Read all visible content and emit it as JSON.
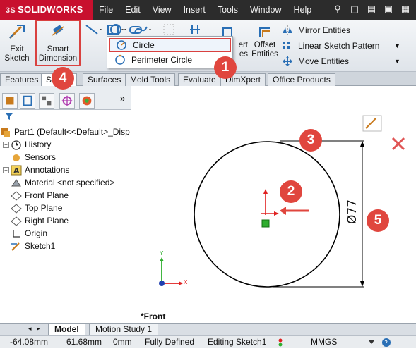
{
  "app": {
    "logo_text": "SOLIDWORKS",
    "logo_prefix": "3S"
  },
  "menu": [
    "File",
    "Edit",
    "View",
    "Insert",
    "Tools",
    "Window",
    "Help"
  ],
  "commands": {
    "exit_sketch": "Exit Sketch",
    "smart_dimension": "Smart Dimension",
    "convert_entities_fragment": "ert\nes",
    "offset_entities": "Offset Entities",
    "mirror_entities": "Mirror Entities",
    "linear_sketch_pattern": "Linear Sketch Pattern",
    "move_entities": "Move Entities"
  },
  "dropdown": {
    "items": [
      "Circle",
      "Perimeter Circle"
    ]
  },
  "ribbon_tabs": [
    "Features",
    "Sketch",
    "Surfaces",
    "Mold Tools",
    "Evaluate",
    "DimXpert",
    "Office Products"
  ],
  "feature_tree": {
    "filter_icon": "filter-icon",
    "root": "Part1  (Default<<Default>_Disp",
    "items": [
      {
        "label": "History",
        "icon": "history-icon",
        "expandable": true
      },
      {
        "label": "Sensors",
        "icon": "sensors-icon",
        "expandable": false
      },
      {
        "label": "Annotations",
        "icon": "annotations-icon",
        "expandable": true
      },
      {
        "label": "Material <not specified>",
        "icon": "material-icon",
        "expandable": false
      },
      {
        "label": "Front Plane",
        "icon": "plane-icon",
        "expandable": false
      },
      {
        "label": "Top Plane",
        "icon": "plane-icon",
        "expandable": false
      },
      {
        "label": "Right Plane",
        "icon": "plane-icon",
        "expandable": false
      },
      {
        "label": "Origin",
        "icon": "origin-icon",
        "expandable": false
      },
      {
        "label": "Sketch1",
        "icon": "sketch-icon",
        "expandable": false
      }
    ]
  },
  "graphics": {
    "view_label": "*Front",
    "dimension": "Ø77",
    "axis_x": "X",
    "axis_y": "Y"
  },
  "markers": [
    "1",
    "2",
    "3",
    "4",
    "5"
  ],
  "bottom_tabs": [
    "Model",
    "Motion Study 1"
  ],
  "status": {
    "x": "-64.08mm",
    "y": "61.68mm",
    "z": "0mm",
    "state": "Fully Defined",
    "editing": "Editing Sketch1",
    "units": "MMGS"
  },
  "colors": {
    "marker": "#e0463e",
    "highlight": "#d9413f",
    "logo_bg": "#c8102e"
  }
}
